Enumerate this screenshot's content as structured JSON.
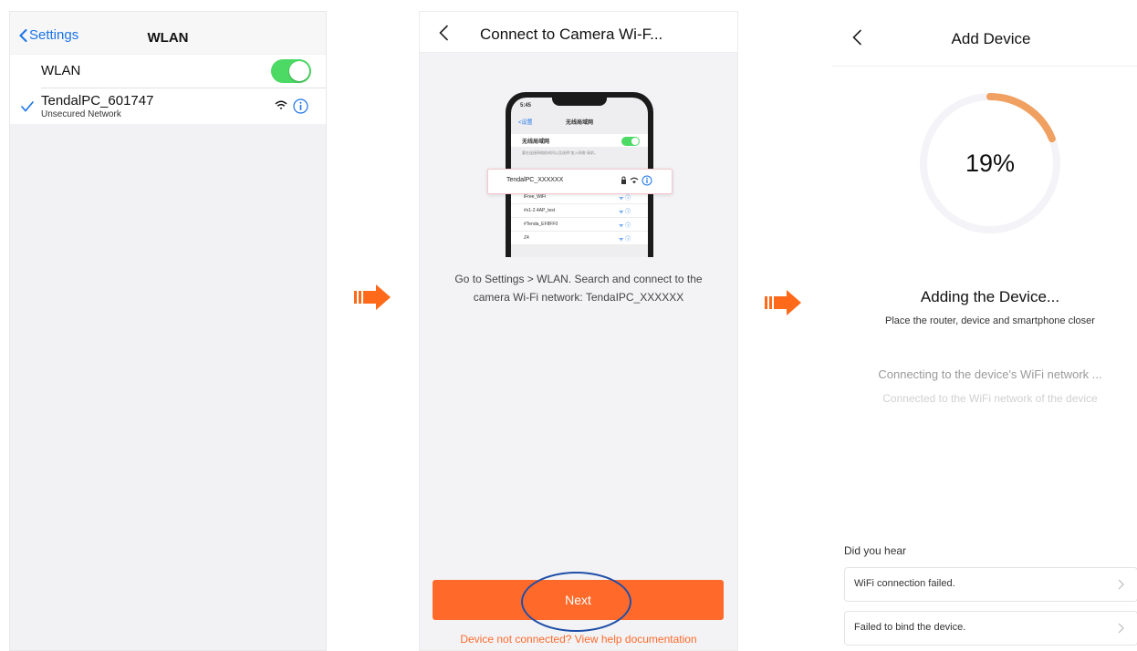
{
  "screen1": {
    "back_label": "Settings",
    "title": "WLAN",
    "wlan_row_label": "WLAN",
    "wlan_enabled": true,
    "network": {
      "ssid": "TendalPC_601747",
      "subtitle": "Unsecured Network",
      "connected": true
    }
  },
  "screen2": {
    "title": "Connect to Camera Wi-F...",
    "phone_mock": {
      "time": "5:45",
      "back": "<设置",
      "title": "无线局域网",
      "wlan_label": "无线局域网",
      "note": "要在连接网络前询问以及选择\"加入网络\"请求。",
      "highlight_ssid": "TendalPC_XXXXXX",
      "networks": [
        "iFree_WiFi",
        "#x1-2.4AP_test",
        "#Tenda_EF8FF0",
        "Z4"
      ]
    },
    "instruction": "Go to Settings > WLAN. Search and connect to the camera Wi-Fi network: TendaIPC_XXXXXX",
    "next_button": "Next",
    "help_link": "Device not connected? View help documentation"
  },
  "screen3": {
    "title": "Add Device",
    "progress_percent": 19,
    "progress_label": "19%",
    "heading": "Adding the Device...",
    "hint": "Place the router, device and smartphone closer",
    "step_current": "Connecting to the device's WiFi network ...",
    "step_next": "Connected to the WiFi network of the device",
    "faq_title": "Did you hear",
    "faq_items": [
      "WiFi connection failed.",
      "Failed to bind the device."
    ]
  },
  "colors": {
    "accent_orange": "#ff6a2b",
    "ios_blue": "#1a73e8",
    "toggle_green": "#4cd964",
    "annotation_blue": "#1f4fa8",
    "progress_orange": "#f0a060"
  }
}
